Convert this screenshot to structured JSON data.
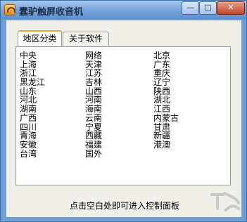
{
  "window": {
    "title": "蠢驴触屏收音机",
    "minimize_glyph": "—",
    "maximize_glyph": "□",
    "close_glyph": "✕"
  },
  "tabs": [
    {
      "label": "地区分类",
      "active": true
    },
    {
      "label": "关于软件",
      "active": false
    }
  ],
  "regions": {
    "column1": [
      "中央",
      "上海",
      "浙江",
      "黑龙江",
      "山东",
      "河北",
      "湖南",
      "广西",
      "四川",
      "青海",
      "安徽",
      "台湾"
    ],
    "column2": [
      "网络",
      "天津",
      "江苏",
      "吉林",
      "山西",
      "河南",
      "海南",
      "云南",
      "宁夏",
      "西藏",
      "福建",
      "国外"
    ],
    "column3": [
      "北京",
      "广东",
      "重庆",
      "辽宁",
      "陕西",
      "湖北",
      "江西",
      "内蒙古",
      "甘肃",
      "新疆",
      "港澳"
    ]
  },
  "hint_text": "点击空白处即可进入控制面板",
  "colors": {
    "titlebar": "#7aa7dd",
    "tab_active_accent": "#e8a33a",
    "client_bg": "#f0efea"
  }
}
